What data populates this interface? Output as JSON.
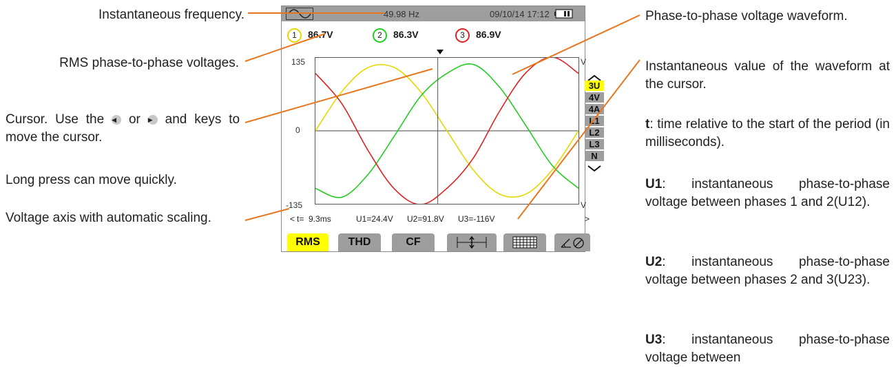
{
  "annotations": {
    "instantaneous_frequency": "Instantaneous frequency.",
    "rms_voltages": "RMS phase-to-phase voltages.",
    "cursor_part1": "Cursor. Use the",
    "cursor_or": "or",
    "cursor_and": "and",
    "cursor_part2": "keys to move the cursor.",
    "long_press": "Long press can move quickly.",
    "voltage_axis": "Voltage axis with automatic scaling.",
    "waveform": "Phase-to-phase voltage waveform.",
    "inst_value": "Instantaneous value of the waveform at the cursor.",
    "t_term": "t",
    "t_desc": ":   time relative to the start of the period (in milliseconds).",
    "u1_term": "U1",
    "u1_desc": ": instantaneous phase-to-phase voltage between phases 1 and 2(U12).",
    "u2_term": "U2",
    "u2_desc": ": instantaneous phase-to-phase voltage between phases 2 and 3(U23).",
    "u3_term": "U3",
    "u3_desc": ": instantaneous phase-to-phase voltage between"
  },
  "screen": {
    "topbar": {
      "frequency": "49.98 Hz",
      "datetime": "09/10/14  17:12",
      "mode_icon": "waveform-icon",
      "battery_icon": "battery-icon"
    },
    "rms": [
      {
        "phase": "1",
        "value": "86.7V",
        "color": "#e6d800"
      },
      {
        "phase": "2",
        "value": "86.3V",
        "color": "#22cc22"
      },
      {
        "phase": "3",
        "value": "86.9V",
        "color": "#e02020"
      }
    ],
    "axis": {
      "ymax": "135",
      "yzero": "0",
      "ymin": "-135",
      "unit_top": "V",
      "unit_bottom": "V"
    },
    "side_buttons": [
      "3U",
      "4V",
      "4A",
      "L1",
      "L2",
      "L3",
      "N"
    ],
    "side_active": "3U",
    "readout": {
      "left_arrow": "<",
      "t": "t=  9.3ms",
      "u1": "U1=24.4V",
      "u2": "U2=91.8V",
      "u3": "U3=-116V",
      "right_arrow": ">"
    },
    "softkeys": [
      {
        "label": "RMS",
        "active": true
      },
      {
        "label": "THD",
        "active": false
      },
      {
        "label": "CF",
        "active": false
      },
      {
        "icon": "scale-icon",
        "active": false
      },
      {
        "icon": "harmonics-table-icon",
        "active": false
      },
      {
        "icon": "phasor-icon",
        "active": false
      }
    ],
    "colors": {
      "accent": "#ffff00",
      "bar": "#9e9e9e",
      "leader": "#e8761e"
    }
  },
  "chart_data": {
    "type": "line",
    "xlabel": "",
    "ylabel": "",
    "ylim": [
      -135,
      135
    ],
    "x_unit": "ms",
    "x": [
      0,
      2,
      4,
      6,
      8,
      10,
      12,
      14,
      16,
      18,
      20
    ],
    "cursor_x": 9.3,
    "series": [
      {
        "color": "#e6d800",
        "values": [
          0,
          72.3,
          117.0,
          117.0,
          72.3,
          0,
          -72.3,
          -117.0,
          -117.0,
          -72.3,
          0
        ]
      },
      {
        "color": "#22cc22",
        "values": [
          -106.3,
          -122.8,
          -80.7,
          -9.6,
          64.0,
          106.3,
          122.8,
          80.7,
          9.6,
          -64.0,
          -106.3
        ]
      },
      {
        "color": "#e02020",
        "values": [
          106.3,
          50.5,
          -36.3,
          -107.4,
          -136.3,
          -106.3,
          -50.5,
          36.3,
          107.4,
          136.3,
          106.3
        ]
      }
    ]
  }
}
